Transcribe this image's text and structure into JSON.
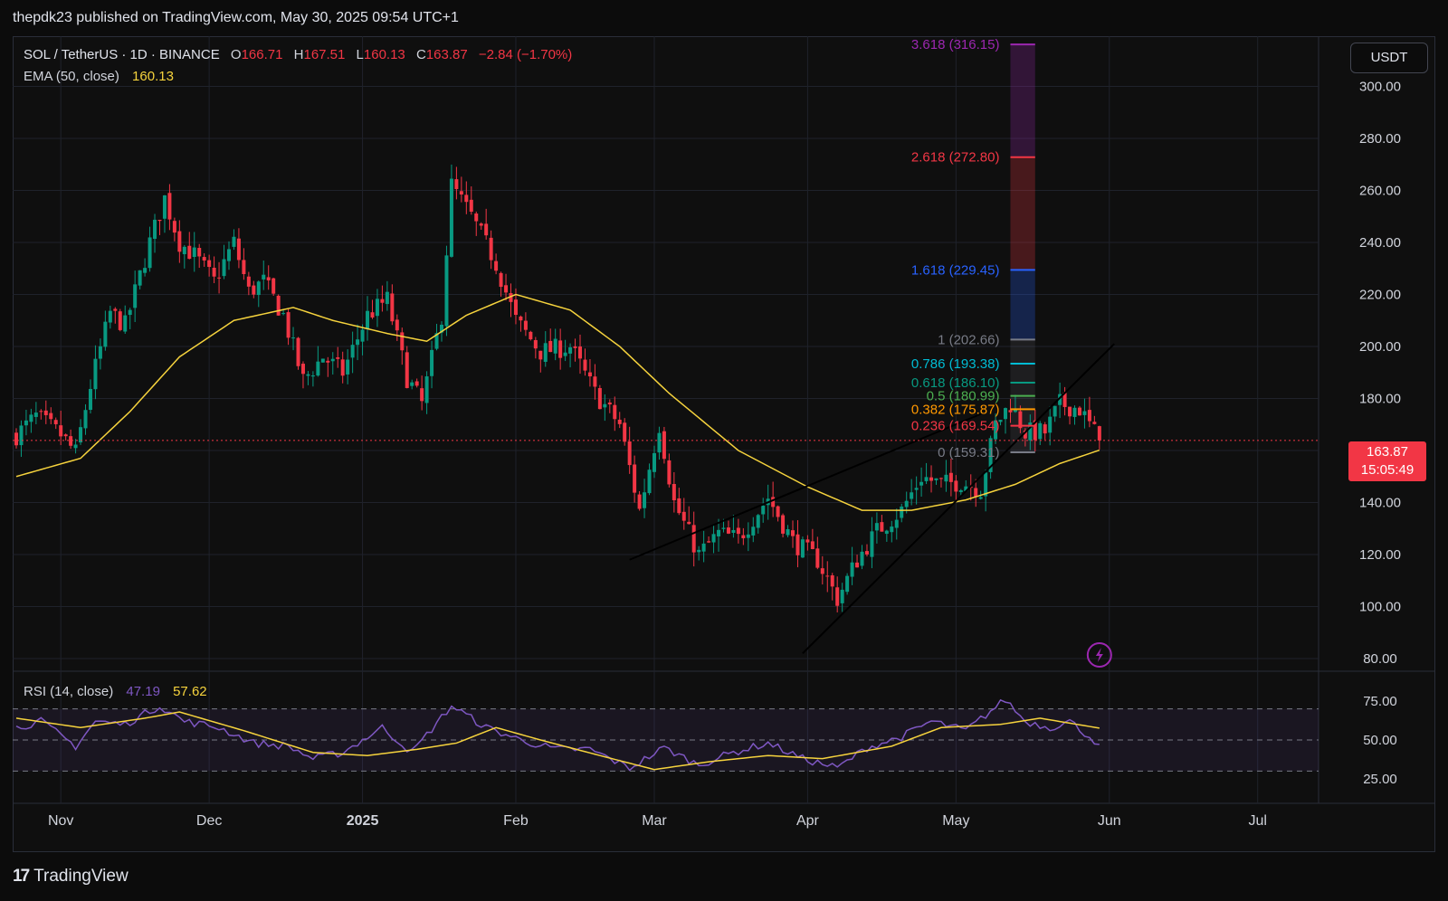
{
  "header": {
    "published": "thepdk23 published on TradingView.com, May 30, 2025 09:54 UTC+1"
  },
  "legend": {
    "symbol": "SOL / TetherUS · 1D · BINANCE",
    "o_label": "O",
    "o_value": "166.71",
    "h_label": "H",
    "h_value": "167.51",
    "l_label": "L",
    "l_value": "160.13",
    "c_label": "C",
    "c_value": "163.87",
    "change": "−2.84 (−1.70%)",
    "ema_label": "EMA (50, close)",
    "ema_value": "160.13",
    "rsi_label": "RSI (14, close)",
    "rsi_value": "47.19",
    "rsi_ma_value": "57.62"
  },
  "currency_button": "USDT",
  "last_price": {
    "price": "163.87",
    "countdown": "15:05:49"
  },
  "footer": {
    "brand": "TradingView"
  },
  "colors": {
    "up": "#089981",
    "down": "#f23645",
    "ema": "#f6d33d",
    "rsi": "#7e57c2",
    "rsi_ma": "#f6d33d"
  },
  "chart_data": [
    {
      "type": "candlestick",
      "title": "SOL / TetherUS · 1D · BINANCE",
      "y_ticks": [
        "300.00",
        "280.00",
        "260.00",
        "240.00",
        "220.00",
        "200.00",
        "180.00",
        "140.00",
        "120.00",
        "100.00",
        "80.00"
      ],
      "x_ticks": [
        "Nov",
        "Dec",
        "2025",
        "Feb",
        "Mar",
        "Apr",
        "May",
        "Jun",
        "Jul"
      ],
      "ylim": [
        80,
        312
      ],
      "anchors": [
        {
          "date": "2024-10-23",
          "close": 166
        },
        {
          "date": "2024-10-27",
          "close": 173
        },
        {
          "date": "2024-11-01",
          "close": 166
        },
        {
          "date": "2024-11-04",
          "close": 159
        },
        {
          "date": "2024-11-07",
          "close": 185
        },
        {
          "date": "2024-11-11",
          "close": 213
        },
        {
          "date": "2024-11-14",
          "close": 208
        },
        {
          "date": "2024-11-19",
          "close": 240
        },
        {
          "date": "2024-11-22",
          "close": 257
        },
        {
          "date": "2024-11-25",
          "close": 240
        },
        {
          "date": "2024-11-28",
          "close": 235
        },
        {
          "date": "2024-12-02",
          "close": 225
        },
        {
          "date": "2024-12-06",
          "close": 240
        },
        {
          "date": "2024-12-09",
          "close": 221
        },
        {
          "date": "2024-12-12",
          "close": 225
        },
        {
          "date": "2024-12-16",
          "close": 212
        },
        {
          "date": "2024-12-20",
          "close": 187
        },
        {
          "date": "2024-12-24",
          "close": 196
        },
        {
          "date": "2024-12-28",
          "close": 190
        },
        {
          "date": "2025-01-02",
          "close": 212
        },
        {
          "date": "2025-01-06",
          "close": 218
        },
        {
          "date": "2025-01-10",
          "close": 188
        },
        {
          "date": "2025-01-13",
          "close": 178
        },
        {
          "date": "2025-01-17",
          "close": 212
        },
        {
          "date": "2025-01-19",
          "close": 262
        },
        {
          "date": "2025-01-23",
          "close": 250
        },
        {
          "date": "2025-01-28",
          "close": 232
        },
        {
          "date": "2025-02-01",
          "close": 210
        },
        {
          "date": "2025-02-06",
          "close": 198
        },
        {
          "date": "2025-02-12",
          "close": 200
        },
        {
          "date": "2025-02-17",
          "close": 182
        },
        {
          "date": "2025-02-22",
          "close": 170
        },
        {
          "date": "2025-02-26",
          "close": 137
        },
        {
          "date": "2025-03-02",
          "close": 170
        },
        {
          "date": "2025-03-05",
          "close": 140
        },
        {
          "date": "2025-03-10",
          "close": 120
        },
        {
          "date": "2025-03-14",
          "close": 128
        },
        {
          "date": "2025-03-18",
          "close": 126
        },
        {
          "date": "2025-03-24",
          "close": 142
        },
        {
          "date": "2025-03-29",
          "close": 125
        },
        {
          "date": "2025-04-03",
          "close": 118
        },
        {
          "date": "2025-04-07",
          "close": 103
        },
        {
          "date": "2025-04-11",
          "close": 118
        },
        {
          "date": "2025-04-15",
          "close": 129
        },
        {
          "date": "2025-04-20",
          "close": 137
        },
        {
          "date": "2025-04-24",
          "close": 150
        },
        {
          "date": "2025-04-28",
          "close": 147
        },
        {
          "date": "2025-05-02",
          "close": 148
        },
        {
          "date": "2025-05-06",
          "close": 145
        },
        {
          "date": "2025-05-09",
          "close": 170
        },
        {
          "date": "2025-05-12",
          "close": 178
        },
        {
          "date": "2025-05-15",
          "close": 167
        },
        {
          "date": "2025-05-19",
          "close": 167
        },
        {
          "date": "2025-05-22",
          "close": 178
        },
        {
          "date": "2025-05-26",
          "close": 176
        },
        {
          "date": "2025-05-30",
          "close": 163.87
        }
      ],
      "ema50": [
        {
          "date": "2024-10-23",
          "value": 150
        },
        {
          "date": "2024-11-05",
          "value": 157
        },
        {
          "date": "2024-11-15",
          "value": 175
        },
        {
          "date": "2024-11-25",
          "value": 196
        },
        {
          "date": "2024-12-06",
          "value": 210
        },
        {
          "date": "2024-12-18",
          "value": 215
        },
        {
          "date": "2024-12-26",
          "value": 210
        },
        {
          "date": "2025-01-06",
          "value": 205
        },
        {
          "date": "2025-01-14",
          "value": 202
        },
        {
          "date": "2025-01-22",
          "value": 212
        },
        {
          "date": "2025-02-01",
          "value": 220
        },
        {
          "date": "2025-02-12",
          "value": 214
        },
        {
          "date": "2025-02-22",
          "value": 200
        },
        {
          "date": "2025-03-04",
          "value": 182
        },
        {
          "date": "2025-03-18",
          "value": 160
        },
        {
          "date": "2025-04-01",
          "value": 146
        },
        {
          "date": "2025-04-12",
          "value": 137
        },
        {
          "date": "2025-04-22",
          "value": 137
        },
        {
          "date": "2025-05-03",
          "value": 141
        },
        {
          "date": "2025-05-13",
          "value": 147
        },
        {
          "date": "2025-05-22",
          "value": 155
        },
        {
          "date": "2025-05-30",
          "value": 160.13
        }
      ],
      "fibonacci": [
        {
          "label": "3.618 (316.15)",
          "value": 316.15,
          "color": "#9c27b0"
        },
        {
          "label": "2.618 (272.80)",
          "value": 272.8,
          "color": "#f23645"
        },
        {
          "label": "1.618 (229.45)",
          "value": 229.45,
          "color": "#2962ff"
        },
        {
          "label": "1 (202.66)",
          "value": 202.66,
          "color": "#787b86"
        },
        {
          "label": "0.786 (193.38)",
          "value": 193.38,
          "color": "#00bcd4"
        },
        {
          "label": "0.618 (186.10)",
          "value": 186.1,
          "color": "#089981"
        },
        {
          "label": "0.5 (180.99)",
          "value": 180.99,
          "color": "#4caf50"
        },
        {
          "label": "0.382 (175.87)",
          "value": 175.87,
          "color": "#ff9800"
        },
        {
          "label": "0.236 (169.54)",
          "value": 169.54,
          "color": "#f23645"
        },
        {
          "label": "0 (159.31)",
          "value": 159.31,
          "color": "#787b86"
        }
      ],
      "trendlines": [
        {
          "start": {
            "date": "2025-02-24",
            "value": 118
          },
          "end": {
            "date": "2025-05-06",
            "value": 174
          }
        },
        {
          "start": {
            "date": "2025-03-31",
            "value": 82
          },
          "end": {
            "date": "2025-06-02",
            "value": 201
          }
        }
      ]
    },
    {
      "type": "line",
      "title": "RSI (14, close)",
      "y_ticks": [
        "75.00",
        "50.00",
        "25.00"
      ],
      "ylim": [
        20,
        78
      ],
      "bands": [
        70,
        50,
        30
      ],
      "anchors": [
        {
          "date": "2024-10-23",
          "value": 58
        },
        {
          "date": "2024-10-28",
          "value": 62
        },
        {
          "date": "2024-11-04",
          "value": 46
        },
        {
          "date": "2024-11-08",
          "value": 62
        },
        {
          "date": "2024-11-14",
          "value": 60
        },
        {
          "date": "2024-11-21",
          "value": 72
        },
        {
          "date": "2024-11-26",
          "value": 62
        },
        {
          "date": "2024-12-03",
          "value": 58
        },
        {
          "date": "2024-12-10",
          "value": 48
        },
        {
          "date": "2024-12-17",
          "value": 46
        },
        {
          "date": "2024-12-22",
          "value": 38
        },
        {
          "date": "2024-12-28",
          "value": 42
        },
        {
          "date": "2025-01-05",
          "value": 58
        },
        {
          "date": "2025-01-11",
          "value": 42
        },
        {
          "date": "2025-01-19",
          "value": 72
        },
        {
          "date": "2025-01-26",
          "value": 58
        },
        {
          "date": "2025-02-02",
          "value": 50
        },
        {
          "date": "2025-02-09",
          "value": 44
        },
        {
          "date": "2025-02-16",
          "value": 44
        },
        {
          "date": "2025-02-24",
          "value": 32
        },
        {
          "date": "2025-03-03",
          "value": 45
        },
        {
          "date": "2025-03-10",
          "value": 34
        },
        {
          "date": "2025-03-17",
          "value": 42
        },
        {
          "date": "2025-03-24",
          "value": 48
        },
        {
          "date": "2025-03-31",
          "value": 38
        },
        {
          "date": "2025-04-07",
          "value": 32
        },
        {
          "date": "2025-04-13",
          "value": 45
        },
        {
          "date": "2025-04-20",
          "value": 52
        },
        {
          "date": "2025-04-26",
          "value": 62
        },
        {
          "date": "2025-05-03",
          "value": 56
        },
        {
          "date": "2025-05-11",
          "value": 76
        },
        {
          "date": "2025-05-15",
          "value": 62
        },
        {
          "date": "2025-05-20",
          "value": 58
        },
        {
          "date": "2025-05-24",
          "value": 62
        },
        {
          "date": "2025-05-30",
          "value": 47.19
        }
      ],
      "ma": [
        {
          "date": "2024-10-23",
          "value": 64
        },
        {
          "date": "2024-11-05",
          "value": 58
        },
        {
          "date": "2024-11-18",
          "value": 64
        },
        {
          "date": "2024-11-25",
          "value": 68
        },
        {
          "date": "2024-12-08",
          "value": 56
        },
        {
          "date": "2024-12-22",
          "value": 42
        },
        {
          "date": "2025-01-02",
          "value": 40
        },
        {
          "date": "2025-01-12",
          "value": 44
        },
        {
          "date": "2025-01-20",
          "value": 48
        },
        {
          "date": "2025-01-28",
          "value": 58
        },
        {
          "date": "2025-02-06",
          "value": 50
        },
        {
          "date": "2025-02-18",
          "value": 40
        },
        {
          "date": "2025-03-01",
          "value": 31
        },
        {
          "date": "2025-03-12",
          "value": 36
        },
        {
          "date": "2025-03-24",
          "value": 40
        },
        {
          "date": "2025-04-04",
          "value": 38
        },
        {
          "date": "2025-04-18",
          "value": 46
        },
        {
          "date": "2025-04-28",
          "value": 58
        },
        {
          "date": "2025-05-10",
          "value": 60
        },
        {
          "date": "2025-05-18",
          "value": 64
        },
        {
          "date": "2025-05-30",
          "value": 57.62
        }
      ]
    }
  ]
}
